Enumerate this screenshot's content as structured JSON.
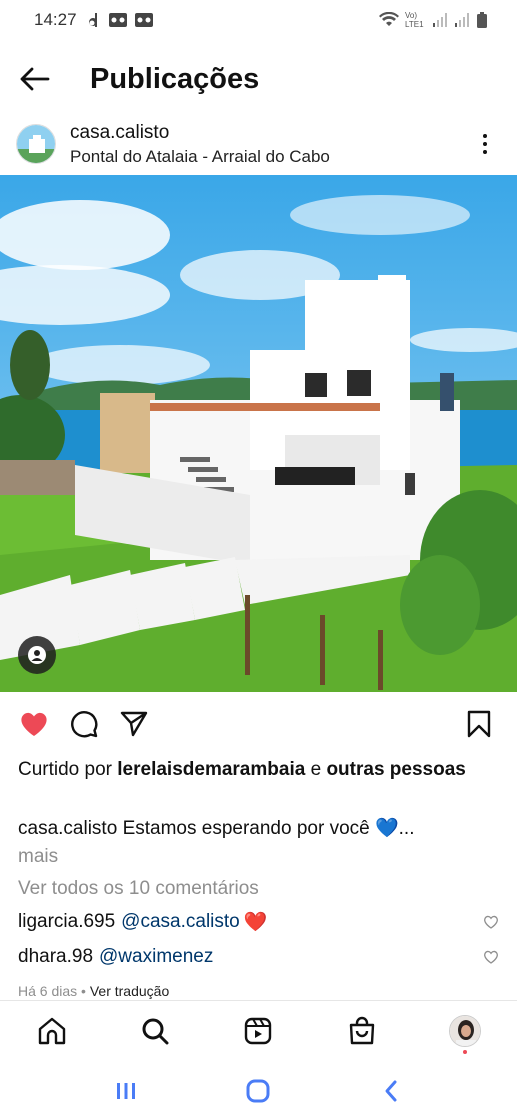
{
  "status_bar": {
    "time": "14:27",
    "network_label": "Vo) LTE1"
  },
  "header": {
    "title": "Publicações"
  },
  "post": {
    "username": "casa.calisto",
    "location": "Pontal do Atalaia - Arraial do Cabo",
    "liked": true,
    "likes_prefix": "Curtido por",
    "likes_user": "lerelaisdemarambaia",
    "likes_joiner": "e",
    "likes_others": "outras pessoas",
    "caption_user": "casa.calisto",
    "caption_text": "Estamos esperando por você 💙...",
    "caption_more": "mais",
    "view_comments": "Ver todos os 10 comentários",
    "comments": [
      {
        "user": "ligarcia.695",
        "mention": "@casa.calisto",
        "emoji": "❤️"
      },
      {
        "user": "dhara.98",
        "mention": "@waximenez",
        "emoji": ""
      }
    ],
    "time_ago": "Há 6 dias",
    "separator": "•",
    "translate": "Ver tradução"
  },
  "colors": {
    "like_red": "#ed4956",
    "link_blue": "#00376b",
    "muted": "#8e8e8e",
    "sys_nav_blue": "#4a7cf6"
  },
  "icons": [
    "back-arrow-icon",
    "more-vertical-icon",
    "tag-person-icon",
    "heart-icon",
    "comment-icon",
    "share-icon",
    "bookmark-icon",
    "home-icon",
    "search-icon",
    "reels-icon",
    "shop-icon",
    "profile-avatar"
  ]
}
